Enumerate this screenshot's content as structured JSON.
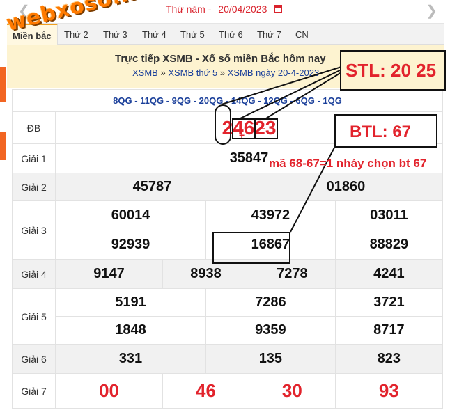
{
  "topbar": {
    "date_label": "Thứ năm -",
    "date_value": "20/04/2023",
    "prev": "❮",
    "next": "❯"
  },
  "tabs": [
    "Miền bắc",
    "Thứ 2",
    "Thứ 3",
    "Thứ 4",
    "Thứ 5",
    "Thứ 6",
    "Thứ 7",
    "CN"
  ],
  "header": {
    "title": "Trực tiếp XSMB - Xổ số miền Bắc hôm nay",
    "crumbs": [
      "XSMB",
      "XSMB thứ 5",
      "XSMB ngày 20-4-2023"
    ],
    "sep": "»"
  },
  "logo": "webxoso.net",
  "results": {
    "ma_db": "8QG - 11QG - 9QG - 20QG - 14QG - 12QG - 6QG - 1QG",
    "db_label": "ĐB",
    "db": "24623",
    "g1_label": "Giải 1",
    "g1": "35847",
    "g2_label": "Giải 2",
    "g2": [
      "45787",
      "01860"
    ],
    "g3_label": "Giải 3",
    "g3": [
      "60014",
      "43972",
      "03011",
      "92939",
      "16867",
      "88829"
    ],
    "g4_label": "Giải 4",
    "g4": [
      "9147",
      "8938",
      "7278",
      "4241"
    ],
    "g5_label": "Giải 5",
    "g5": [
      "5191",
      "7286",
      "3721",
      "1848",
      "9359",
      "8717"
    ],
    "g6_label": "Giải 6",
    "g6": [
      "331",
      "135",
      "823"
    ],
    "g7_label": "Giải 7",
    "g7": [
      "00",
      "46",
      "30",
      "93"
    ]
  },
  "annotations": {
    "stl": "STL: 20 25",
    "btl": "BTL: 67",
    "note": "mã 68-67=1 nháy chọn bt 67",
    "plus": "+",
    "minus": "-"
  },
  "colors": {
    "red": "#e2232c",
    "blue": "#1a3f9a",
    "header_bg": "#fdf3d0",
    "accent": "#f26522"
  }
}
